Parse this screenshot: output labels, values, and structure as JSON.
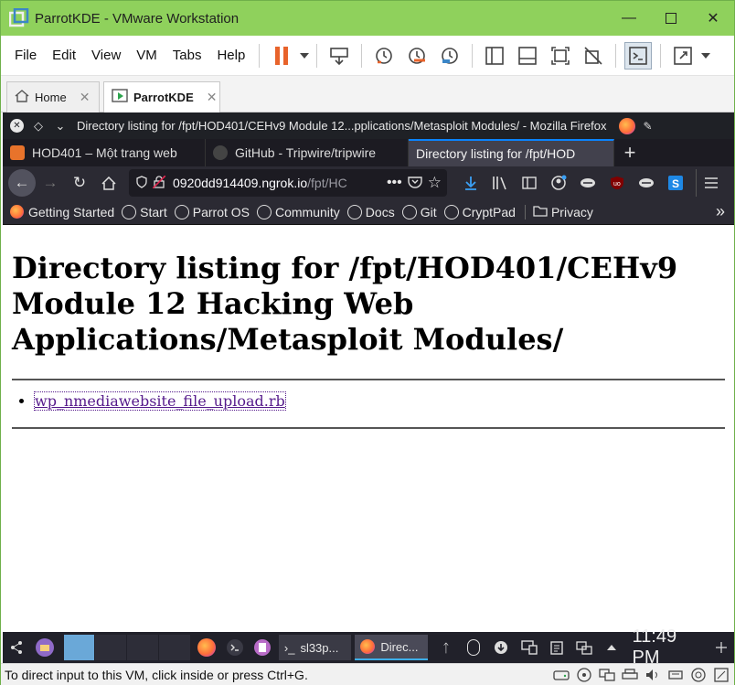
{
  "vmware": {
    "window_title": "ParrotKDE - VMware Workstation",
    "menu": [
      "File",
      "Edit",
      "View",
      "VM",
      "Tabs",
      "Help"
    ],
    "tabs": [
      {
        "label": "Home"
      },
      {
        "label": "ParrotKDE"
      }
    ],
    "status_message": "To direct input to this VM, click inside or press Ctrl+G.",
    "colors": {
      "titlebar": "#8fd15c",
      "pause": "#e8632b"
    }
  },
  "firefox": {
    "window_title": "Directory listing for /fpt/HOD401/CEHv9 Module 12...pplications/Metasploit Modules/ - Mozilla Firefox",
    "tabs": [
      {
        "label": "HOD401 – Một trang web"
      },
      {
        "label": "GitHub - Tripwire/tripwire"
      },
      {
        "label": "Directory listing for /fpt/HOD"
      }
    ],
    "url_host": "0920dd914409.ngrok.io",
    "url_path": "/fpt/HC",
    "bookmarks": [
      "Getting Started",
      "Start",
      "Parrot OS",
      "Community",
      "Docs",
      "Git",
      "CryptPad",
      "Privacy"
    ]
  },
  "page": {
    "heading": "Directory listing for /fpt/HOD401/CEHv9 Module 12 Hacking Web Applications/Metasploit Modules/",
    "files": [
      "wp_nmediawebsite_file_upload.rb"
    ]
  },
  "taskbar": {
    "tasks": [
      {
        "label": "sl33p..."
      },
      {
        "label": "Direc..."
      }
    ],
    "clock": "11:49 PM"
  }
}
